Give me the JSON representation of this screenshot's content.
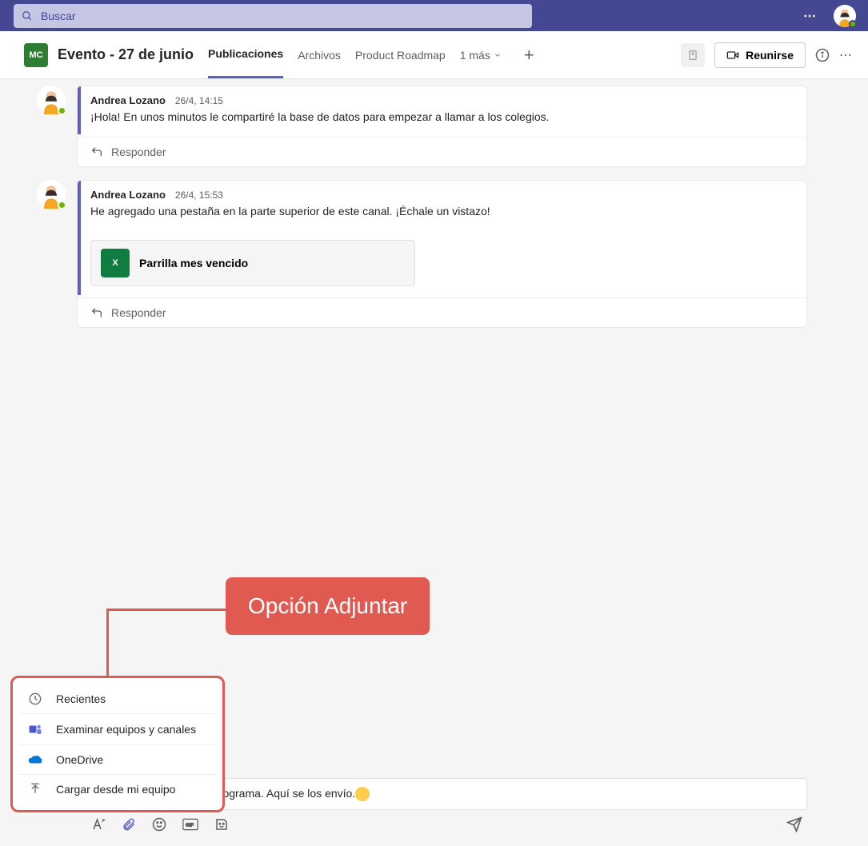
{
  "search": {
    "placeholder": "Buscar"
  },
  "header": {
    "avatar_initials": "MC",
    "title": "Evento - 27 de junio",
    "tabs": [
      "Publicaciones",
      "Archivos",
      "Product Roadmap"
    ],
    "more_tabs": "1 más",
    "meet_label": "Reunirse"
  },
  "posts": [
    {
      "author": "Andrea Lozano",
      "time": "26/4, 14:15",
      "body": "¡Hola! En unos minutos le compartiré la base de datos para empezar a llamar a los colegios.",
      "reply": "Responder"
    },
    {
      "author": "Andrea Lozano",
      "time": "26/4, 15:53",
      "body": "He agregado una pestaña en la parte superior de este canal. ¡Échale un vistazo!",
      "attachment": "Parrilla mes vencido",
      "reply": "Responder"
    }
  ],
  "composer": {
    "text_prefix": "ban de aprobarnos el cronograma. Aquí se los envío."
  },
  "attach_menu": {
    "recent": "Recientes",
    "browse": "Examinar equipos y canales",
    "onedrive": "OneDrive",
    "upload": "Cargar desde mi equipo"
  },
  "callout": "Opción Adjuntar",
  "excel_icon_text": "X"
}
